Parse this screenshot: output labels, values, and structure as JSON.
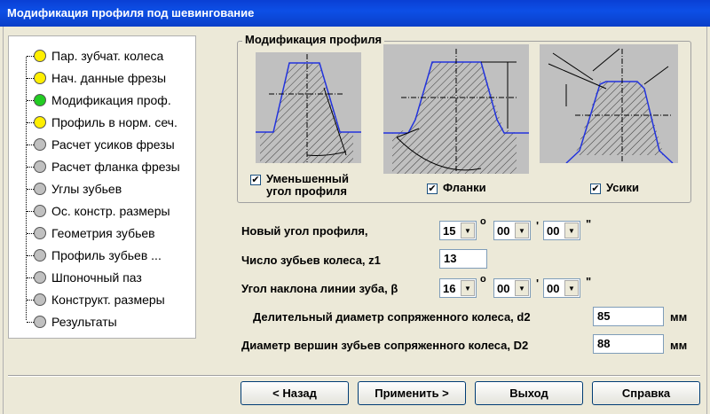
{
  "window": {
    "title": "Модификация профиля под шевингование"
  },
  "sidebar": {
    "items": [
      {
        "label": "Пар. зубчат. колеса",
        "color": "#ffef00"
      },
      {
        "label": "Нач. данные фрезы",
        "color": "#ffef00"
      },
      {
        "label": "Модификация проф.",
        "color": "#22cc22"
      },
      {
        "label": "Профиль в норм. сеч.",
        "color": "#ffef00"
      },
      {
        "label": "Расчет усиков фрезы",
        "color": "#c0c0c0"
      },
      {
        "label": "Расчет фланка фрезы",
        "color": "#c0c0c0"
      },
      {
        "label": "Углы зубьев",
        "color": "#c0c0c0"
      },
      {
        "label": "Ос. констр. размеры",
        "color": "#c0c0c0"
      },
      {
        "label": "Геометрия зубьев",
        "color": "#c0c0c0"
      },
      {
        "label": "Профиль зубьев ...",
        "color": "#c0c0c0"
      },
      {
        "label": "Шпоночный паз",
        "color": "#c0c0c0"
      },
      {
        "label": "Конструкт. размеры",
        "color": "#c0c0c0"
      },
      {
        "label": "Результаты",
        "color": "#c0c0c0"
      }
    ]
  },
  "modification": {
    "title": "Модификация профиля",
    "reduced_angle": {
      "label1": "Уменьшенный",
      "label2": "угол профиля",
      "checked": "✔"
    },
    "flanks": {
      "label": "Фланки",
      "checked": "✔"
    },
    "whiskers": {
      "label": "Усики",
      "checked": "✔"
    }
  },
  "form": {
    "new_profile_angle": {
      "label": "Новый угол профиля,",
      "deg": "15",
      "min": "00",
      "sec": "00"
    },
    "teeth_count": {
      "label": "Число зубьев колеса, z1",
      "value": "13"
    },
    "helix_angle": {
      "label": "Угол наклона линии зуба, β",
      "deg": "16",
      "min": "00",
      "sec": "00"
    },
    "pitch_diameter": {
      "label": "Делительный диаметр сопряженного колеса, d2",
      "value": "85",
      "unit": "мм"
    },
    "tip_diameter": {
      "label": "Диаметр вершин зубьев сопряженного  колеса, D2",
      "value": "88",
      "unit": "мм"
    },
    "deg_symbol": "o",
    "min_symbol": "'",
    "sec_symbol": "\""
  },
  "buttons": {
    "back": "< Назад",
    "apply": "Применить >",
    "exit": "Выход",
    "help": "Справка"
  }
}
